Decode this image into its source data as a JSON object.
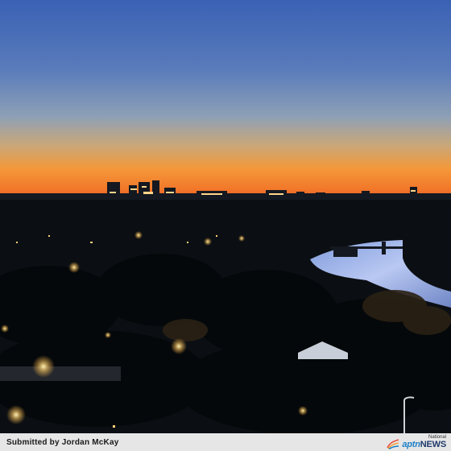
{
  "photo": {
    "subject": "city-skyline-at-dusk-over-river",
    "palette": {
      "sky_top": "#3b63b4",
      "sky_mid": "#6f8db9",
      "sky_haze": "#c7a679",
      "horizon_glow": "#f58e2e",
      "horizon_red": "#e0552a",
      "foreground": "#0b0f13",
      "river": "#9fb4e8",
      "city_lights": "#ffd58a"
    }
  },
  "caption": {
    "credit": "Submitted by Jordan McKay"
  },
  "logo": {
    "small": "National",
    "aptn": "aptn",
    "news": "NEWS",
    "icon": "aptn-feather-icon"
  }
}
